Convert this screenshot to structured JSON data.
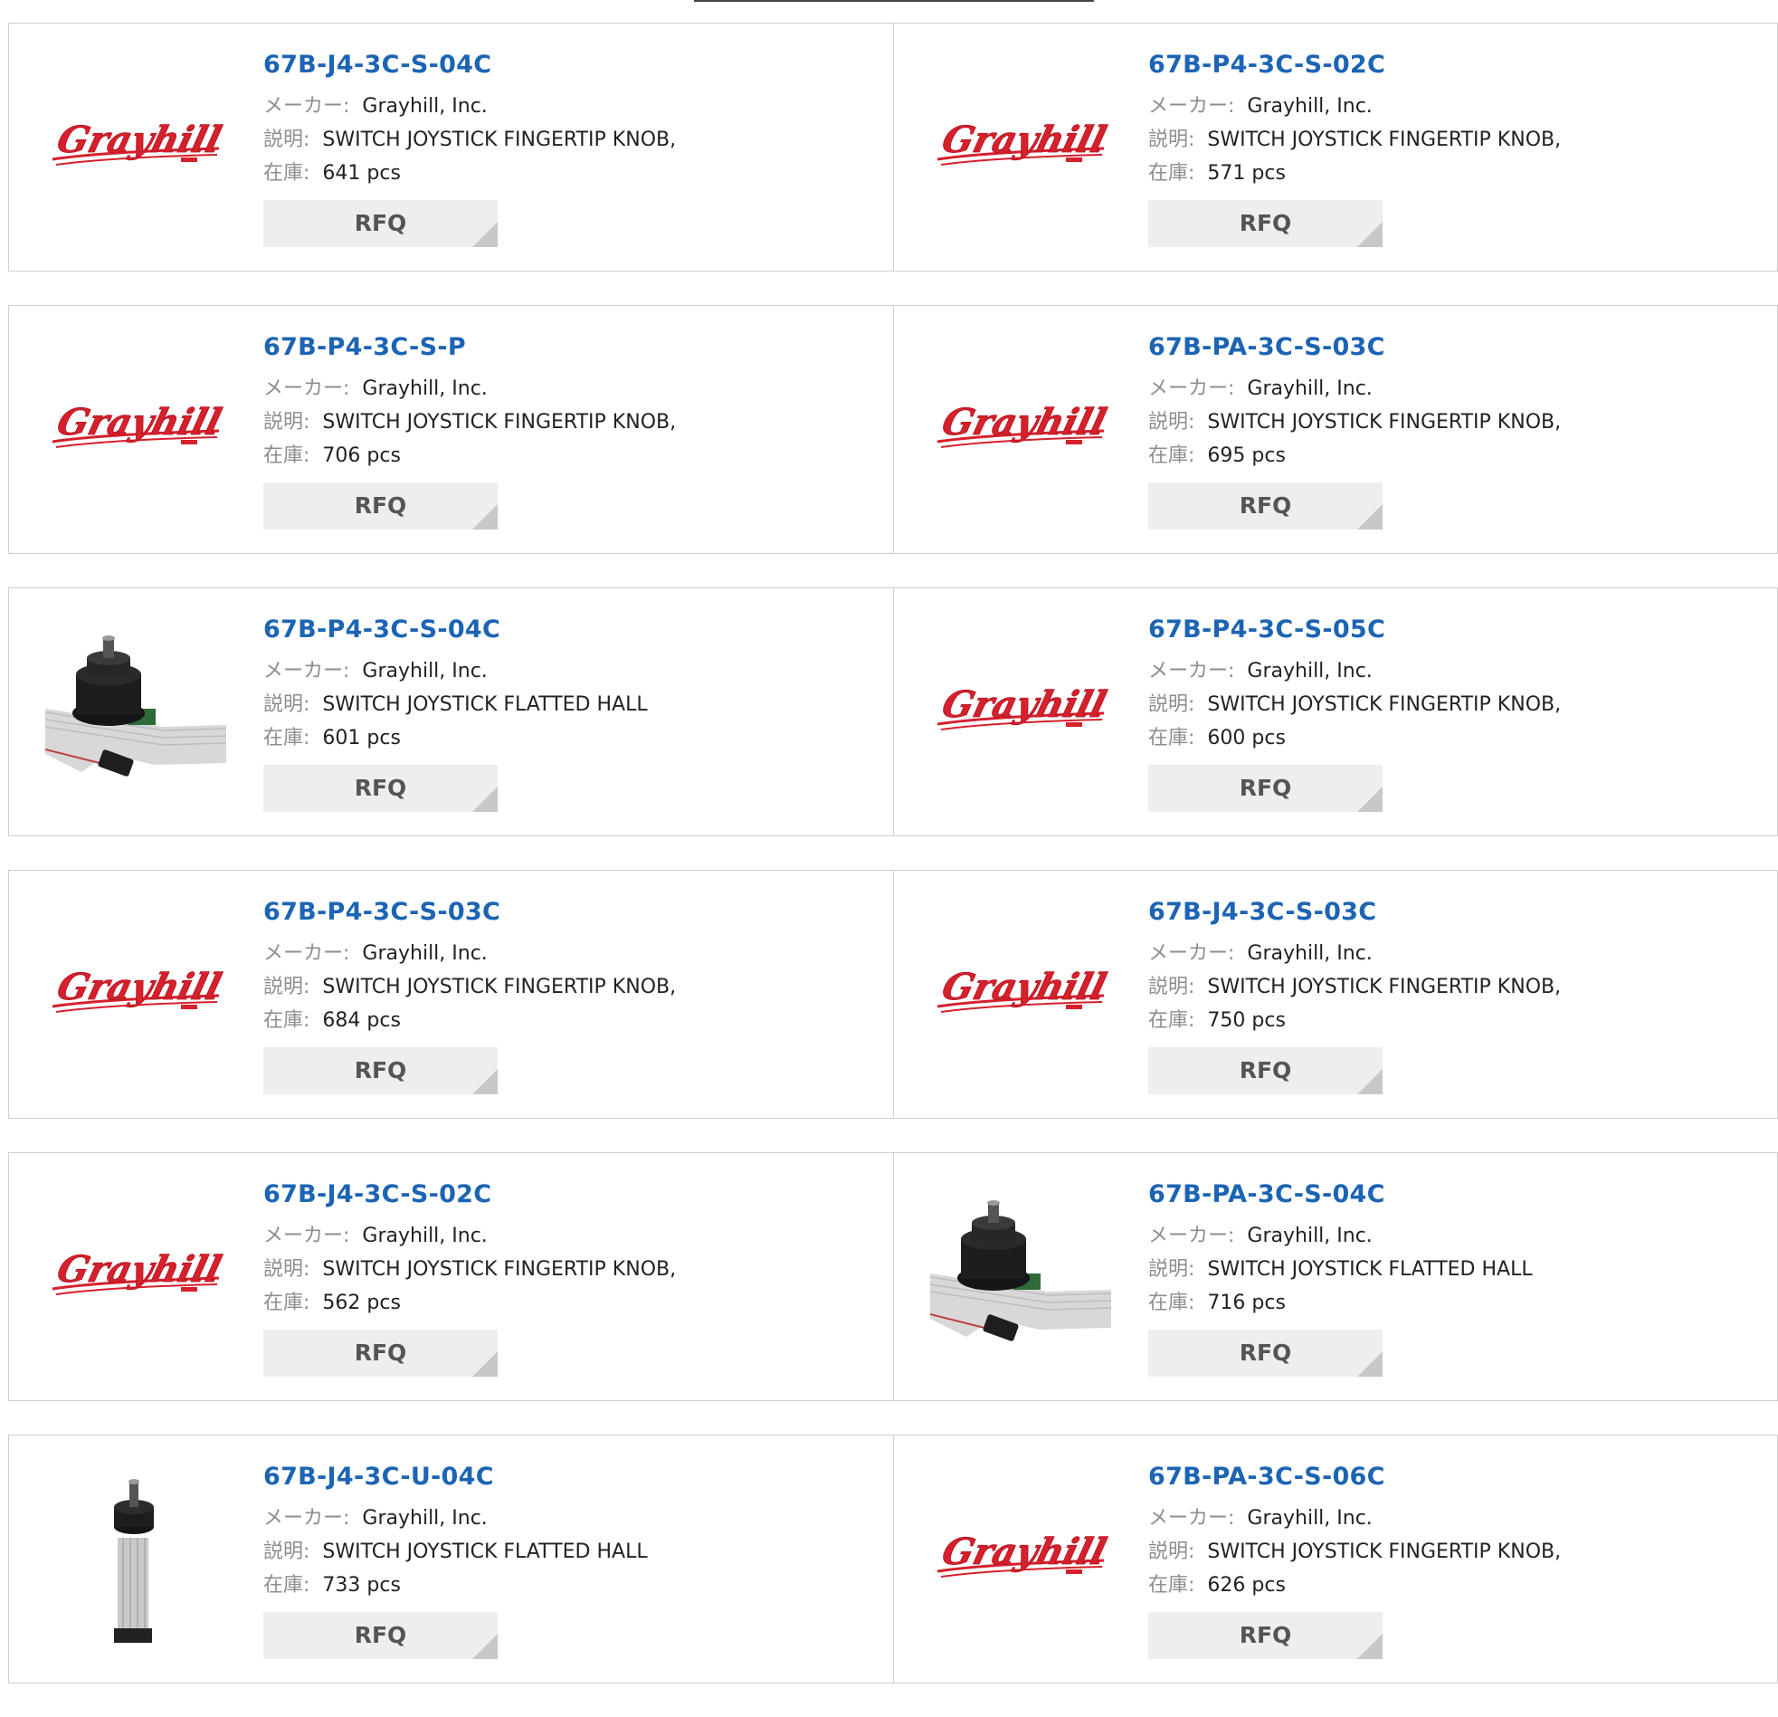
{
  "labels": {
    "maker": "メーカー:",
    "desc": "説明:",
    "stock": "在庫:",
    "rfq": "RFQ"
  },
  "products": [
    {
      "part": "67B-J4-3C-S-04C",
      "maker": "Grayhill, Inc.",
      "desc": "SWITCH JOYSTICK FINGERTIP KNOB,",
      "stock": "641 pcs",
      "image": "grayhill-logo"
    },
    {
      "part": "67B-P4-3C-S-02C",
      "maker": "Grayhill, Inc.",
      "desc": "SWITCH JOYSTICK FINGERTIP KNOB,",
      "stock": "571 pcs",
      "image": "grayhill-logo"
    },
    {
      "part": "67B-P4-3C-S-P",
      "maker": "Grayhill, Inc.",
      "desc": "SWITCH JOYSTICK FINGERTIP KNOB,",
      "stock": "706 pcs",
      "image": "grayhill-logo"
    },
    {
      "part": "67B-PA-3C-S-03C",
      "maker": "Grayhill, Inc.",
      "desc": "SWITCH JOYSTICK FINGERTIP KNOB,",
      "stock": "695 pcs",
      "image": "grayhill-logo"
    },
    {
      "part": "67B-P4-3C-S-04C",
      "maker": "Grayhill, Inc.",
      "desc": "SWITCH JOYSTICK FLATTED HALL",
      "stock": "601 pcs",
      "image": "joystick-ribbon-photo"
    },
    {
      "part": "67B-P4-3C-S-05C",
      "maker": "Grayhill, Inc.",
      "desc": "SWITCH JOYSTICK FINGERTIP KNOB,",
      "stock": "600 pcs",
      "image": "grayhill-logo"
    },
    {
      "part": "67B-P4-3C-S-03C",
      "maker": "Grayhill, Inc.",
      "desc": "SWITCH JOYSTICK FINGERTIP KNOB,",
      "stock": "684 pcs",
      "image": "grayhill-logo"
    },
    {
      "part": "67B-J4-3C-S-03C",
      "maker": "Grayhill, Inc.",
      "desc": "SWITCH JOYSTICK FINGERTIP KNOB,",
      "stock": "750 pcs",
      "image": "grayhill-logo"
    },
    {
      "part": "67B-J4-3C-S-02C",
      "maker": "Grayhill, Inc.",
      "desc": "SWITCH JOYSTICK FINGERTIP KNOB,",
      "stock": "562 pcs",
      "image": "grayhill-logo"
    },
    {
      "part": "67B-PA-3C-S-04C",
      "maker": "Grayhill, Inc.",
      "desc": "SWITCH JOYSTICK FLATTED HALL",
      "stock": "716 pcs",
      "image": "joystick-ribbon-photo"
    },
    {
      "part": "67B-J4-3C-U-04C",
      "maker": "Grayhill, Inc.",
      "desc": "SWITCH JOYSTICK FLATTED HALL",
      "stock": "733 pcs",
      "image": "joystick-vertical-photo"
    },
    {
      "part": "67B-PA-3C-S-06C",
      "maker": "Grayhill, Inc.",
      "desc": "SWITCH JOYSTICK FINGERTIP KNOB,",
      "stock": "626 pcs",
      "image": "grayhill-logo"
    }
  ],
  "colors": {
    "link": "#1c64b4",
    "logo_red": "#d6202c",
    "rfq_bg": "#eeeeee",
    "border": "#cfcfcf"
  }
}
